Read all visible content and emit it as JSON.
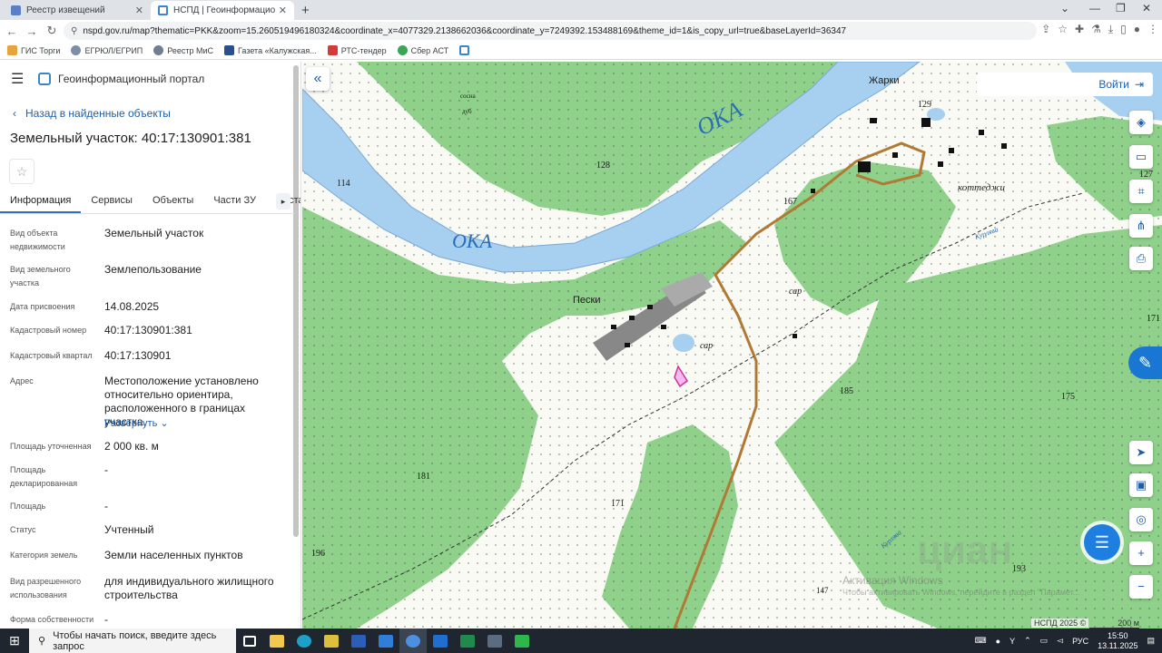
{
  "browser": {
    "tabs": [
      {
        "title": "Реестр извещений",
        "active": false
      },
      {
        "title": "НСПД | Геоинформационный п",
        "active": true
      }
    ],
    "url": "nspd.gov.ru/map?thematic=PKK&zoom=15.260519496180324&coordinate_x=4077329.2138662036&coordinate_y=7249392.153488169&theme_id=1&is_copy_url=true&baseLayerId=36347",
    "bookmarks": [
      "ГИС Торги",
      "ЕГРЮЛ/ЕГРИП",
      "Реестр МиС",
      "Газета «Калужская...",
      "РТС-тендер",
      "Сбер АСТ"
    ]
  },
  "panel": {
    "portal_title": "Геоинформационный портал",
    "back_label": "Назад в найденные объекты",
    "object_title": "Земельный участок: 40:17:130901:381",
    "tabs": [
      "Информация",
      "Сервисы",
      "Объекты",
      "Части ЗУ",
      "Соста"
    ],
    "fields": [
      {
        "label": "Вид объекта недвижимости",
        "value": "Земельный участок"
      },
      {
        "label": "Вид земельного участка",
        "value": "Землепользование"
      },
      {
        "label": "Дата присвоения",
        "value": "14.08.2025"
      },
      {
        "label": "Кадастровый номер",
        "value": "40:17:130901:381"
      },
      {
        "label": "Кадастровый квартал",
        "value": "40:17:130901"
      },
      {
        "label": "Адрес",
        "value": "Местоположение установлено относительно ориентира, расположенного в границах участка."
      },
      {
        "label": "Площадь уточненная",
        "value": "2 000 кв. м"
      },
      {
        "label": "Площадь декларированная",
        "value": "-"
      },
      {
        "label": "Площадь",
        "value": "-"
      },
      {
        "label": "Статус",
        "value": "Учтенный"
      },
      {
        "label": "Категория земель",
        "value": "Земли населенных пунктов"
      },
      {
        "label": "Вид разрешенного использования",
        "value": "для индивидуального жилищного строительства"
      },
      {
        "label": "Форма собственности",
        "value": "-"
      }
    ],
    "expand_link": "Развернуть"
  },
  "map": {
    "login_label": "Войти",
    "labels": {
      "oka_upper": "ОКА",
      "oka_lower": "ОКА",
      "peski": "Пески",
      "zharki": "Жарки",
      "kottedzhi": "коттеджи",
      "sar1": "сар",
      "sar2": "сар",
      "kurlyava1": "Курлява",
      "kurlyava2": "Курлява",
      "sosna": "сосна",
      "dub": "дуб",
      "h128": "128",
      "h129": "129",
      "h127": "127",
      "h114": "114",
      "h167": "167",
      "h185": "185",
      "h175": "175",
      "h171a": "171",
      "h171b": "171",
      "h181": "181",
      "h196": "196",
      "h193": "193",
      "h147": "147"
    },
    "watermark_title": "Активация Windows",
    "watermark_text": "Чтобы активировать Windows, перейдите в раздел \"Парамет...",
    "cian_watermark": "циан",
    "copyright": "НСПД 2025 ©",
    "scale_label": "200 м"
  },
  "taskbar": {
    "search_placeholder": "Чтобы начать поиск, введите здесь запрос",
    "lang": "РУС",
    "time": "15:50",
    "date": "13.11.2025"
  }
}
